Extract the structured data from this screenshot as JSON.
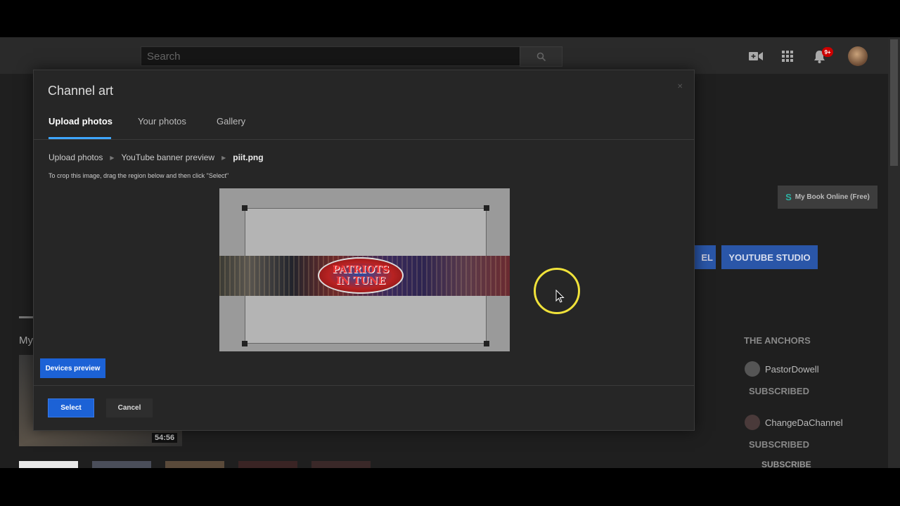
{
  "topbar": {
    "search_placeholder": "Search",
    "notification_badge": "9+",
    "icons": [
      "search-icon",
      "video-camera-icon",
      "apps-grid-icon",
      "bell-icon",
      "avatar"
    ]
  },
  "background": {
    "my_book_button": "My Book Online (Free)",
    "channel_button_fragment": "EL",
    "studio_button": "YOUTUBE STUDIO",
    "section_label": "My",
    "video_duration": "54:56",
    "anchors_title": "THE ANCHORS",
    "channels": [
      {
        "name": "PastorDowell",
        "status": "SUBSCRIBED"
      },
      {
        "name": "ChangeDaChannel",
        "status": "SUBSCRIBED"
      }
    ],
    "subscribe_label": "SUBSCRIBE"
  },
  "modal": {
    "title": "Channel art",
    "tabs": [
      {
        "label": "Upload photos",
        "active": true
      },
      {
        "label": "Your photos",
        "active": false
      },
      {
        "label": "Gallery",
        "active": false
      }
    ],
    "breadcrumb": [
      "Upload photos",
      "YouTube banner preview",
      "piit.png"
    ],
    "instruction": "To crop this image, drag the region below and then click \"Select\"",
    "banner_text": [
      "PATRIOTS",
      "IN TUNE"
    ],
    "devices_preview_button": "Devices preview",
    "select_button": "Select",
    "cancel_button": "Cancel"
  },
  "colors": {
    "accent_blue": "#1c62d6",
    "active_tab_underline": "#3ea6ff",
    "cursor_highlight": "#f0e23a",
    "notification_red": "#cc0000"
  }
}
